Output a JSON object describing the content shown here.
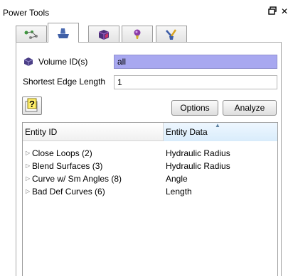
{
  "window": {
    "title": "Power Tools",
    "float_icon": "restore-icon",
    "close_glyph": "✕"
  },
  "tabs": [
    {
      "icon": "node-network-icon",
      "active": false
    },
    {
      "icon": "geometry-icon",
      "active": true
    },
    {
      "icon": "volume-cube-icon",
      "active": false
    },
    {
      "icon": "mesh-pin-icon",
      "active": false
    },
    {
      "icon": "cleanup-tool-icon",
      "active": false
    }
  ],
  "form": {
    "volume_label": "Volume ID(s)",
    "volume_value": "all",
    "edge_label": "Shortest Edge Length",
    "edge_value": "1",
    "options_label": "Options",
    "analyze_label": "Analyze"
  },
  "tree": {
    "columns": [
      "Entity ID",
      "Entity Data"
    ],
    "rows": [
      {
        "id": "Close Loops (2)",
        "data": "Hydraulic Radius"
      },
      {
        "id": "Blend Surfaces (3)",
        "data": "Hydraulic Radius"
      },
      {
        "id": "Curve w/ Sm Angles (8)",
        "data": "Angle"
      },
      {
        "id": "Bad Def Curves (6)",
        "data": "Length"
      }
    ]
  },
  "colors": {
    "selected_input": "#a8a8f0",
    "sorted_column": "#d9ecfb"
  }
}
